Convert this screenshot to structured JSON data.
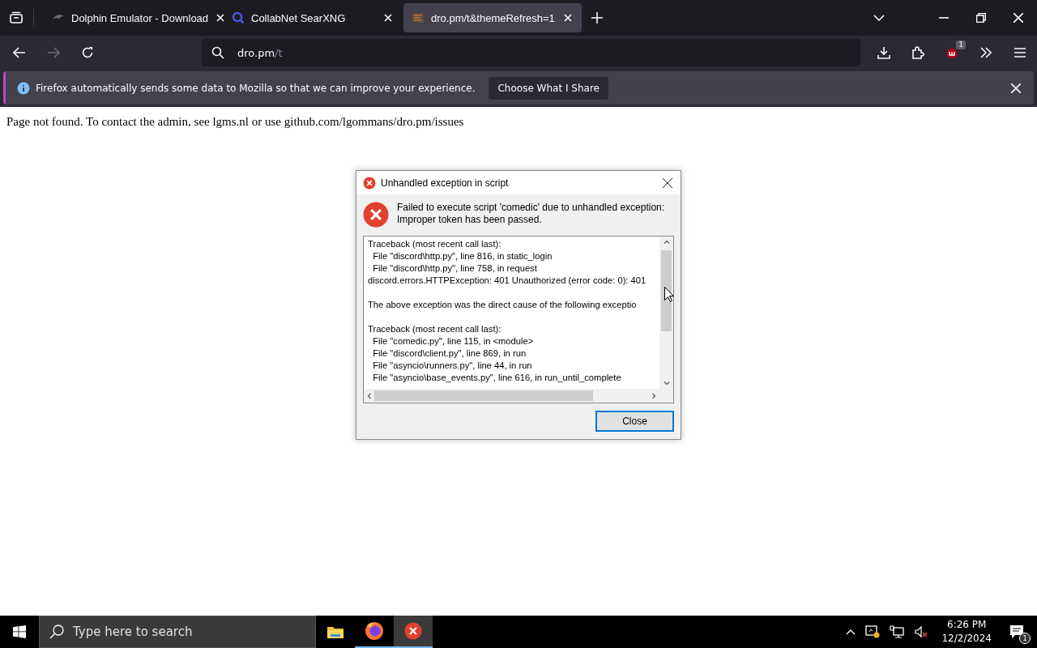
{
  "browser": {
    "tabs": [
      {
        "label": "Dolphin Emulator - Download",
        "kind": "dolphin",
        "selected": false
      },
      {
        "label": "CollabNet SearXNG",
        "kind": "search",
        "selected": false
      },
      {
        "label": "dro.pm/t&themeRefresh=1",
        "kind": "site",
        "selected": true
      }
    ],
    "address": {
      "host": "dro.pm",
      "path": "/t"
    },
    "extension_badge": "1",
    "notification": {
      "text": "Firefox automatically sends some data to Mozilla so that we can improve your experience.",
      "button": "Choose What I Share"
    }
  },
  "page": {
    "text": "Page not found. To contact the admin, see lgms.nl or use github.com/lgommans/dro.pm/issues"
  },
  "dialog": {
    "title": "Unhandled exception in script",
    "message": [
      "Failed to execute script 'comedic' due to unhandled exception:",
      "Improper token has been passed."
    ],
    "traceback": [
      {
        "lines": [
          "Traceback (most recent call last):",
          "  File \"discord\\http.py\", line 816, in static_login",
          "  File \"discord\\http.py\", line 758, in request",
          "discord.errors.HTTPException: 401 Unauthorized (error code: 0): 401"
        ]
      },
      {
        "lines": [
          "The above exception was the direct cause of the following exceptio"
        ]
      },
      {
        "lines": [
          "Traceback (most recent call last):",
          "  File \"comedic.py\", line 115, in <module>",
          "  File \"discord\\client.py\", line 869, in run",
          "  File \"asyncio\\runners.py\", line 44, in run",
          "  File \"asyncio\\base_events.py\", line 616, in run_until_complete"
        ]
      }
    ],
    "button": "Close"
  },
  "taskbar": {
    "search_placeholder": "Type here to search",
    "apps": [
      {
        "kind": "folder",
        "running": false,
        "active": false
      },
      {
        "kind": "firefox",
        "running": true,
        "active": false
      },
      {
        "kind": "error",
        "running": true,
        "active": true
      }
    ],
    "time": "6:26 PM",
    "date": "12/2/2024",
    "notification_count": "1"
  }
}
